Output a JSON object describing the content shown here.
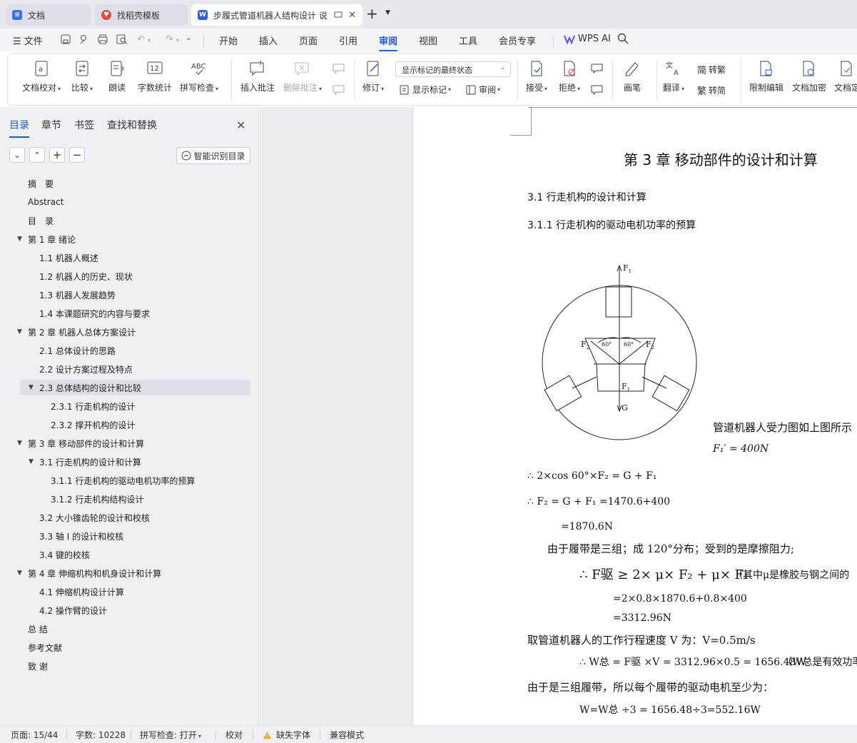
{
  "tabs": [
    {
      "label": "文档",
      "icon": "doc-icon"
    },
    {
      "label": "找稻壳模板",
      "icon": "docer-icon"
    },
    {
      "label": "步履式管道机器人结构设计 说",
      "icon": "word-icon"
    }
  ],
  "menu": {
    "file": "文件",
    "items": [
      "开始",
      "插入",
      "页面",
      "引用",
      "审阅",
      "视图",
      "工具",
      "会员专享"
    ],
    "active": "审阅",
    "wps_ai": "WPS AI"
  },
  "ribbon": {
    "proofread": "文档校对",
    "compare": "比较",
    "read_aloud": "朗读",
    "word_count": "字数统计",
    "spell_check": "拼写检查",
    "insert_comment": "插入批注",
    "delete_comment": "删除批注",
    "track_changes": "修订",
    "markup_state": "显示标记的最终状态",
    "show_markup": "显示标记",
    "review": "审阅",
    "accept": "接受",
    "reject": "拒绝",
    "ink": "画笔",
    "translate": "翻译",
    "to_traditional": "转繁",
    "to_simplified": "转简",
    "restrict_edit": "限制编辑",
    "encrypt": "文档加密",
    "doc_finalize": "文档定",
    "word_count_icon_text": "12",
    "spell_icon_text": "ABC"
  },
  "nav": {
    "tabs": [
      "目录",
      "章节",
      "书签",
      "查找和替换"
    ],
    "active_tab": "目录",
    "smart_toc": "智能识别目录"
  },
  "toc": [
    {
      "label": "摘　要",
      "level": 1,
      "expand": "",
      "selected": false
    },
    {
      "label": "Abstract",
      "level": 1,
      "expand": "",
      "selected": false
    },
    {
      "label": "目　录",
      "level": 1,
      "expand": "",
      "selected": false
    },
    {
      "label": "第 1 章  绪论",
      "level": 1,
      "expand": "▼",
      "selected": false
    },
    {
      "label": "1.1  机器人概述",
      "level": 2,
      "expand": "",
      "selected": false
    },
    {
      "label": "1.2  机器人的历史、现状",
      "level": 2,
      "expand": "",
      "selected": false
    },
    {
      "label": "1.3 机器人发展趋势",
      "level": 2,
      "expand": "",
      "selected": false
    },
    {
      "label": "1.4  本课题研究的内容与要求",
      "level": 2,
      "expand": "",
      "selected": false
    },
    {
      "label": "第 2 章  机器人总体方案设计",
      "level": 1,
      "expand": "▼",
      "selected": false
    },
    {
      "label": "2.1 总体设计的思路",
      "level": 2,
      "expand": "",
      "selected": false
    },
    {
      "label": "2.2  设计方案过程及特点",
      "level": 2,
      "expand": "",
      "selected": false
    },
    {
      "label": "2.3  总体结构的设计和比较",
      "level": 2,
      "expand": "▼",
      "selected": true
    },
    {
      "label": "2.3.1  行走机构的设计",
      "level": 3,
      "expand": "",
      "selected": false
    },
    {
      "label": "2.3.2  撑开机构的设计",
      "level": 3,
      "expand": "",
      "selected": false
    },
    {
      "label": "第 3 章  移动部件的设计和计算",
      "level": 1,
      "expand": "▼",
      "selected": false
    },
    {
      "label": "3.1  行走机构的设计和计算",
      "level": 2,
      "expand": "▼",
      "selected": false
    },
    {
      "label": "3.1.1  行走机构的驱动电机功率的预算",
      "level": 3,
      "expand": "",
      "selected": false
    },
    {
      "label": "3.1.2  行走机构结构设计",
      "level": 3,
      "expand": "",
      "selected": false
    },
    {
      "label": "3.2 大小锥齿轮的设计和校核",
      "level": 2,
      "expand": "",
      "selected": false
    },
    {
      "label": "3.3  轴 I 的设计和校核",
      "level": 2,
      "expand": "",
      "selected": false
    },
    {
      "label": "3.4  键的校核",
      "level": 2,
      "expand": "",
      "selected": false
    },
    {
      "label": "第 4 章  伸缩机构和机身设计和计算",
      "level": 1,
      "expand": "▼",
      "selected": false
    },
    {
      "label": "4.1  伸缩机构设计计算",
      "level": 2,
      "expand": "",
      "selected": false
    },
    {
      "label": "4.2  操作臂的设计",
      "level": 2,
      "expand": "",
      "selected": false
    },
    {
      "label": "总 结",
      "level": 1,
      "expand": "",
      "selected": false
    },
    {
      "label": "参考文献",
      "level": 1,
      "expand": "",
      "selected": false
    },
    {
      "label": "致 谢",
      "level": 1,
      "expand": "",
      "selected": false
    }
  ],
  "doc": {
    "chapter_title": "第 3 章  移动部件的设计和计算",
    "h2": "3.1  行走机构的设计和计算",
    "h3": "3.1.1  行走机构的驱动电机功率的预算",
    "fig_labels": {
      "f1_top": "F",
      "f1_top_sub": "1",
      "f2_left": "F",
      "f2_left_sub": "2",
      "f2_right": "F",
      "f2_right_sub": "2",
      "angle_left": "60°",
      "angle_right": "60°",
      "f1_inner": "F",
      "f1_inner_sub": "1",
      "g": "G"
    },
    "force_caption": "管道机器人受力图如上图所示",
    "f1_value": "F₁′ = 400N",
    "eq1": "∴ 2×cos 60°×F₂ = G + F₁",
    "eq2": "∴ F₂ = G + F₁ =1470.6+400",
    "eq3": "=1870.6N",
    "text1": "由于履带是三组；成 120°分布；受到的是摩擦阻力;",
    "eq4": "∴ F驱 ≥ 2× μ× F₂ + μ× F₁",
    "eq4_note": "（其中μ是橡胶与钢之间的",
    "eq5": "=2×0.8×1870.6+0.8×400",
    "eq6": "=3312.96N",
    "text2": "取管道机器人的工作行程速度 V 为：V=0.5m/s",
    "eq7": "∴ W总 = F驱 ×V = 3312.96×0.5 = 1656.48W",
    "eq7_note": "（W总是有效功率",
    "text3": "由于是三组履带，所以每个履带的驱动电机至少为：",
    "eq8": "W=W总 ÷3 = 1656.48÷3=552.16W"
  },
  "status": {
    "page": "页面: 15/44",
    "words": "字数: 10228",
    "spell": "拼写检查: 打开",
    "proof": "校对",
    "missing_font": "缺失字体",
    "compat": "兼容模式"
  },
  "colors": {
    "accent": "#1c58f7",
    "word_blue": "#2b5ce6",
    "docer_red": "#e5483c",
    "warning": "#f5a623"
  }
}
